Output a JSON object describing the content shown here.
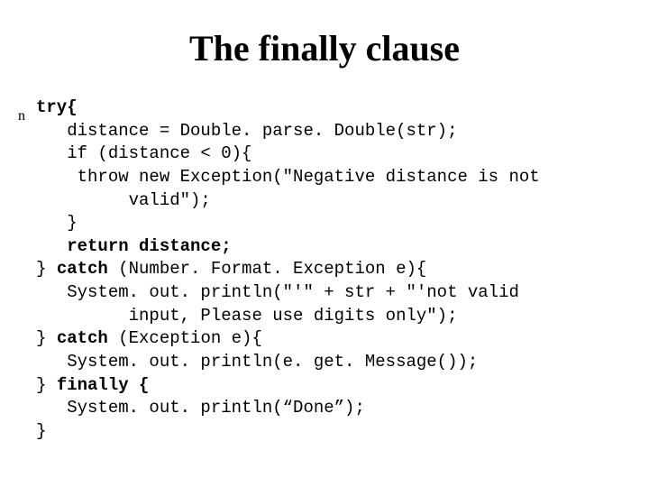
{
  "title": "The finally clause",
  "bullet": "n",
  "code": {
    "l1_kw": "try{",
    "l2": "   distance = Double. parse. Double(str);",
    "l3": "   if (distance < 0){",
    "l4": "    throw new Exception(\"Negative distance is not",
    "l5": "         valid\");",
    "l6": "   }",
    "l7_kw": "   return distance;",
    "l8a": "} ",
    "l8_kw": "catch",
    "l8b": " (Number. Format. Exception e){",
    "l9": "   System. out. println(\"'\" + str + \"'not valid",
    "l10": "         input, Please use digits only\");",
    "l11a": "} ",
    "l11_kw": "catch",
    "l11b": " (Exception e){",
    "l12": "   System. out. println(e. get. Message());",
    "l13a": "} ",
    "l13_kw": "finally {",
    "l14": "   System. out. println(“Done”);",
    "l15": "}"
  }
}
